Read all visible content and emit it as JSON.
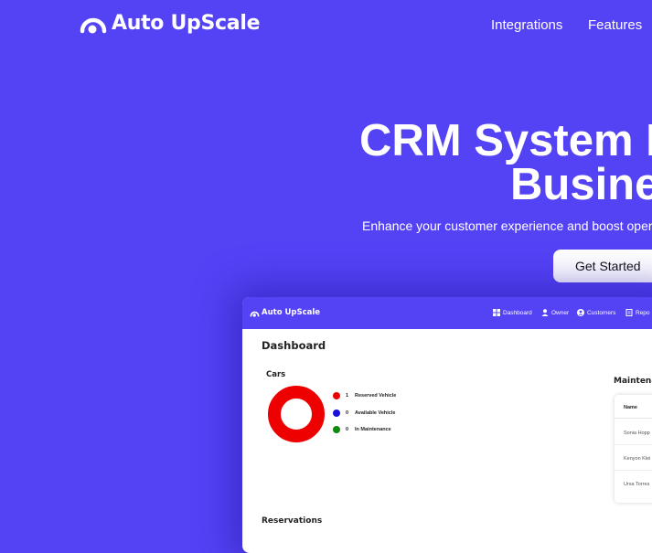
{
  "header": {
    "brand": "Auto UpScale",
    "nav": [
      {
        "label": "Integrations"
      },
      {
        "label": "Features"
      }
    ]
  },
  "hero": {
    "title_line1": "CRM System F",
    "title_line2": "Busine",
    "subtitle": "Enhance your customer experience and boost oper",
    "cta_label": "Get Started"
  },
  "mockup": {
    "brand": "Auto UpScale",
    "nav": [
      {
        "label": "Dashboard",
        "icon": "windows-icon"
      },
      {
        "label": "Owner",
        "icon": "user-icon"
      },
      {
        "label": "Customers",
        "icon": "user-circle-icon"
      },
      {
        "label": "Repo",
        "icon": "report-icon"
      }
    ],
    "dashboard_title": "Dashboard",
    "cars": {
      "title": "Cars",
      "legend": [
        {
          "value": "1",
          "label": "Reserved Vehicle",
          "color": "#ee0000"
        },
        {
          "value": "0",
          "label": "Available Vehicle",
          "color": "#1a10d8"
        },
        {
          "value": "0",
          "label": "In Maintenance",
          "color": "#0b8a0b"
        }
      ]
    },
    "maintenance": {
      "title": "Maintena",
      "column": "Name",
      "rows": [
        "Sonia Hopp",
        "Kenyon Klei",
        "Ursa Torres"
      ]
    },
    "reservations_title": "Reservations"
  },
  "chart_data": {
    "type": "pie",
    "title": "Cars",
    "categories": [
      "Reserved Vehicle",
      "Available Vehicle",
      "In Maintenance"
    ],
    "values": [
      1,
      0,
      0
    ],
    "colors": [
      "#ee0000",
      "#1a10d8",
      "#0b8a0b"
    ],
    "legend": "right"
  },
  "colors": {
    "brand": "#5442f5",
    "donut": "#ee0000"
  }
}
